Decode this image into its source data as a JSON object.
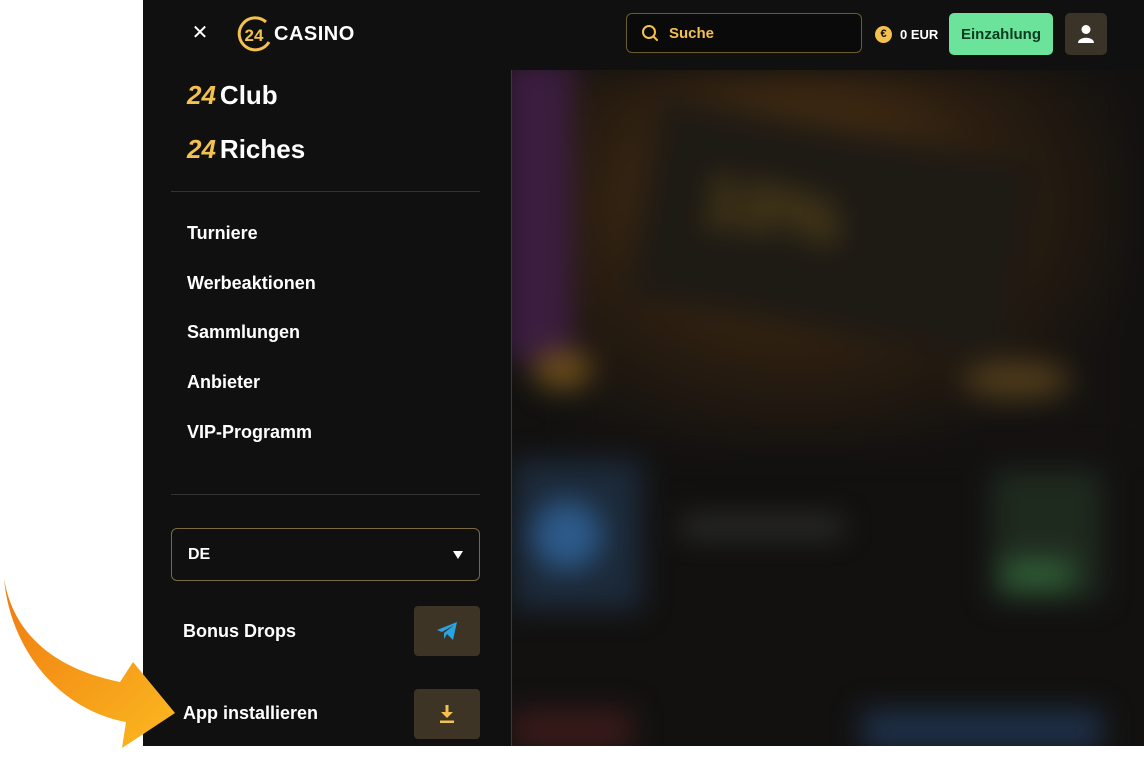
{
  "header": {
    "logo_number": "24",
    "logo_text": "CASINO",
    "search_placeholder": "Suche",
    "balance": "0 EUR",
    "currency_symbol": "€",
    "deposit_label": "Einzahlung"
  },
  "sidebar": {
    "brands": [
      {
        "num": "24",
        "name": "Club"
      },
      {
        "num": "24",
        "name": "Riches"
      }
    ],
    "nav": [
      "Turniere",
      "Werbeaktionen",
      "Sammlungen",
      "Anbieter",
      "VIP-Programm"
    ],
    "language": "DE",
    "bonus_drops_label": "Bonus Drops",
    "app_install_label": "App installieren"
  },
  "hero_promo": "10%",
  "colors": {
    "accent": "#f2c14e",
    "deposit": "#6be39a",
    "telegram": "#2aa3e0",
    "arrow": "#f59a1c"
  },
  "icons": [
    "close-icon",
    "search-icon",
    "euro-coin-icon",
    "user-icon",
    "chevron-down-icon",
    "telegram-icon",
    "download-icon"
  ]
}
